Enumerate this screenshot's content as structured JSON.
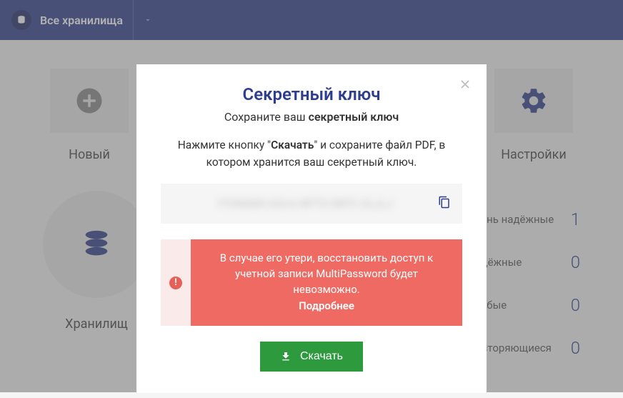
{
  "topbar": {
    "title": "Все хранилища"
  },
  "cards": {
    "new": "Новый",
    "settings": "Настройки"
  },
  "vault_label": "Хранилищ",
  "stats": [
    {
      "name": "Очень надёжные",
      "count": "1",
      "color": "green"
    },
    {
      "name": "Надёжные",
      "count": "0",
      "color": "blue"
    },
    {
      "name": "Слабые",
      "count": "0",
      "color": "red"
    },
    {
      "name": "Повторяющиеся",
      "count": "0",
      "color": "orange"
    }
  ],
  "modal": {
    "title": "Секретный ключ",
    "sub_prefix": "Сохраните ваш ",
    "sub_bold": "секретный ключ",
    "desc_pre": "Нажмите кнопку \"",
    "desc_bold": "Скачать",
    "desc_post": "\" и сохраните файл PDF, в котором хранится ваш секретный ключ.",
    "key_masked": "FYGNAEK-ASLA-NPTX-QRYC-XLJLJ",
    "alert_text": "В случае его утери, восстановить доступ к учетной записи MultiPassword будет невозможно.",
    "alert_more": "Подробнее",
    "download": "Скачать"
  }
}
